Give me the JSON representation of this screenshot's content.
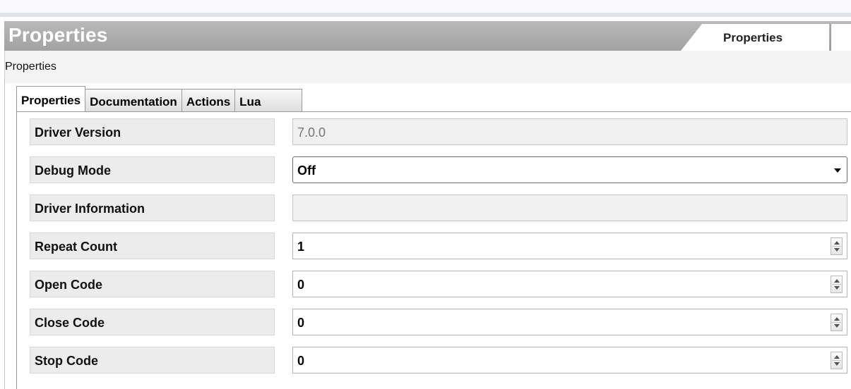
{
  "header": {
    "title": "Properties",
    "tab_label": "Properties"
  },
  "subtitle": "Properties",
  "tabs": [
    {
      "label": "Properties",
      "active": true
    },
    {
      "label": "Documentation",
      "active": false
    },
    {
      "label": "Actions",
      "active": false
    },
    {
      "label": "Lua",
      "active": false
    }
  ],
  "properties": [
    {
      "label": "Driver Version",
      "value": "7.0.0",
      "type": "readonly"
    },
    {
      "label": "Debug Mode",
      "value": "Off",
      "type": "dropdown"
    },
    {
      "label": "Driver Information",
      "value": "",
      "type": "readonly"
    },
    {
      "label": "Repeat Count",
      "value": "1",
      "type": "spinner"
    },
    {
      "label": "Open Code",
      "value": "0",
      "type": "spinner"
    },
    {
      "label": "Close Code",
      "value": "0",
      "type": "spinner"
    },
    {
      "label": "Stop Code",
      "value": "0",
      "type": "spinner"
    }
  ],
  "icons": {
    "dropdown": "chevron-down-icon",
    "spinner": "spin-up-down-icon"
  }
}
